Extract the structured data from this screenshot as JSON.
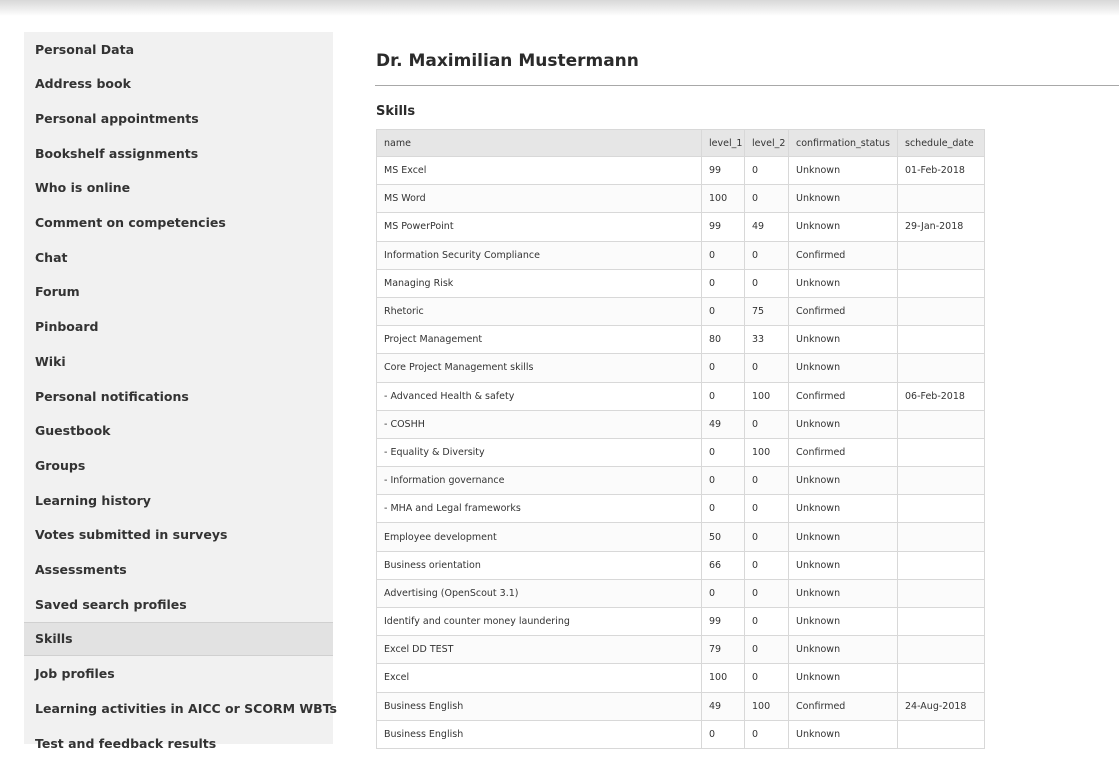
{
  "sidebar": {
    "items": [
      {
        "label": "Personal Data"
      },
      {
        "label": "Address book"
      },
      {
        "label": "Personal appointments"
      },
      {
        "label": "Bookshelf assignments"
      },
      {
        "label": "Who is online"
      },
      {
        "label": "Comment on competencies"
      },
      {
        "label": "Chat"
      },
      {
        "label": "Forum"
      },
      {
        "label": "Pinboard"
      },
      {
        "label": "Wiki"
      },
      {
        "label": "Personal notifications"
      },
      {
        "label": "Guestbook"
      },
      {
        "label": "Groups"
      },
      {
        "label": "Learning history"
      },
      {
        "label": "Votes submitted in surveys"
      },
      {
        "label": "Assessments"
      },
      {
        "label": "Saved search profiles"
      },
      {
        "label": "Skills"
      },
      {
        "label": "Job profiles"
      },
      {
        "label": "Learning activities in AICC or SCORM WBTs"
      },
      {
        "label": "Test and feedback results"
      }
    ],
    "active_item": "Skills"
  },
  "main": {
    "page_title": "Dr. Maximilian Mustermann",
    "section_title": "Skills",
    "table": {
      "columns": [
        "name",
        "level_1",
        "level_2",
        "confirmation_status",
        "schedule_date"
      ],
      "rows": [
        [
          "MS Excel",
          "99",
          "0",
          "Unknown",
          "01-Feb-2018"
        ],
        [
          "MS Word",
          "100",
          "0",
          "Unknown",
          ""
        ],
        [
          "MS PowerPoint",
          "99",
          "49",
          "Unknown",
          "29-Jan-2018"
        ],
        [
          "Information Security Compliance",
          "0",
          "0",
          "Confirmed",
          ""
        ],
        [
          "Managing Risk",
          "0",
          "0",
          "Unknown",
          ""
        ],
        [
          "Rhetoric",
          "0",
          "75",
          "Confirmed",
          ""
        ],
        [
          "Project Management",
          "80",
          "33",
          "Unknown",
          ""
        ],
        [
          "Core Project Management skills",
          "0",
          "0",
          "Unknown",
          ""
        ],
        [
          "- Advanced Health & safety",
          "0",
          "100",
          "Confirmed",
          "06-Feb-2018"
        ],
        [
          "- COSHH",
          "49",
          "0",
          "Unknown",
          ""
        ],
        [
          "- Equality & Diversity",
          "0",
          "100",
          "Confirmed",
          ""
        ],
        [
          "- Information governance",
          "0",
          "0",
          "Unknown",
          ""
        ],
        [
          "- MHA and Legal frameworks",
          "0",
          "0",
          "Unknown",
          ""
        ],
        [
          "Employee development",
          "50",
          "0",
          "Unknown",
          ""
        ],
        [
          "Business orientation",
          "66",
          "0",
          "Unknown",
          ""
        ],
        [
          "Advertising (OpenScout 3.1)",
          "0",
          "0",
          "Unknown",
          ""
        ],
        [
          "Identify and counter money laundering",
          "99",
          "0",
          "Unknown",
          ""
        ],
        [
          "Excel DD TEST",
          "79",
          "0",
          "Unknown",
          ""
        ],
        [
          "Excel",
          "100",
          "0",
          "Unknown",
          ""
        ],
        [
          "Business English",
          "49",
          "100",
          "Confirmed",
          "24-Aug-2018"
        ],
        [
          "Business English",
          "0",
          "0",
          "Unknown",
          ""
        ]
      ]
    }
  }
}
